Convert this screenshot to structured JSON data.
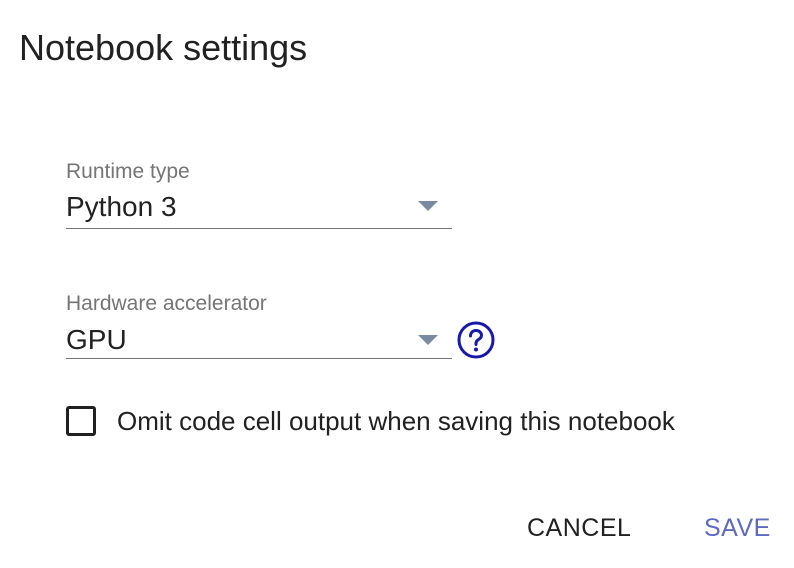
{
  "dialog": {
    "title": "Notebook settings"
  },
  "runtime_type": {
    "label": "Runtime type",
    "selected": "Python 3"
  },
  "hardware_accelerator": {
    "label": "Hardware accelerator",
    "selected": "GPU",
    "help_icon": "help-circle-icon"
  },
  "omit_output": {
    "label": "Omit code cell output when saving this notebook",
    "checked": false
  },
  "actions": {
    "cancel_label": "CANCEL",
    "save_label": "SAVE"
  },
  "colors": {
    "accent": "#5c6bc0",
    "help_icon": "#1a1aaa",
    "text": "#212121",
    "secondary_text": "#757575",
    "caret": "#7a8aa0"
  }
}
